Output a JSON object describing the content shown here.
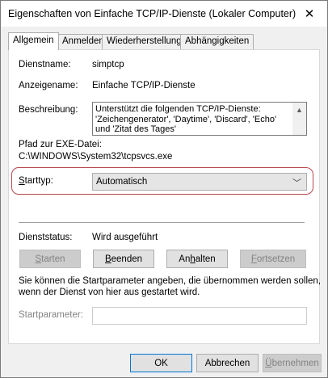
{
  "window": {
    "title": "Eigenschaften von Einfache TCP/IP-Dienste (Lokaler Computer)",
    "close_glyph": "✕"
  },
  "tabs": [
    {
      "label": "Allgemein",
      "active": true
    },
    {
      "label": "Anmelden",
      "active": false
    },
    {
      "label": "Wiederherstellung",
      "active": false
    },
    {
      "label": "Abhängigkeiten",
      "active": false
    }
  ],
  "general": {
    "service_name_label": "Dienstname:",
    "service_name_value": "simptcp",
    "display_name_label": "Anzeigename:",
    "display_name_value": "Einfache TCP/IP-Dienste",
    "description_label": "Beschreibung:",
    "description_value": "Unterstützt die folgenden TCP/IP-Dienste: 'Zeichengenerator', 'Daytime', 'Discard', 'Echo' und 'Zitat des Tages'",
    "path_label": "Pfad zur EXE-Datei:",
    "path_value": "C:\\WINDOWS\\System32\\tcpsvcs.exe",
    "starttype_label": "Starttyp:",
    "starttype_value": "Automatisch",
    "status_label": "Dienststatus:",
    "status_value": "Wird ausgeführt",
    "buttons": {
      "start": "Starten",
      "stop": "Beenden",
      "pause": "Anhalten",
      "resume": "Fortsetzen"
    },
    "hint_line1": "Sie können die Startparameter angeben, die übernommen werden sollen,",
    "hint_line2": "wenn der Dienst von hier aus gestartet wird.",
    "startparam_label": "Startparameter:",
    "startparam_value": ""
  },
  "footer": {
    "ok": "OK",
    "cancel": "Abbrechen",
    "apply": "Übernehmen"
  },
  "colors": {
    "highlight_ring": "#b8474d",
    "default_button_border": "#0078d7"
  }
}
